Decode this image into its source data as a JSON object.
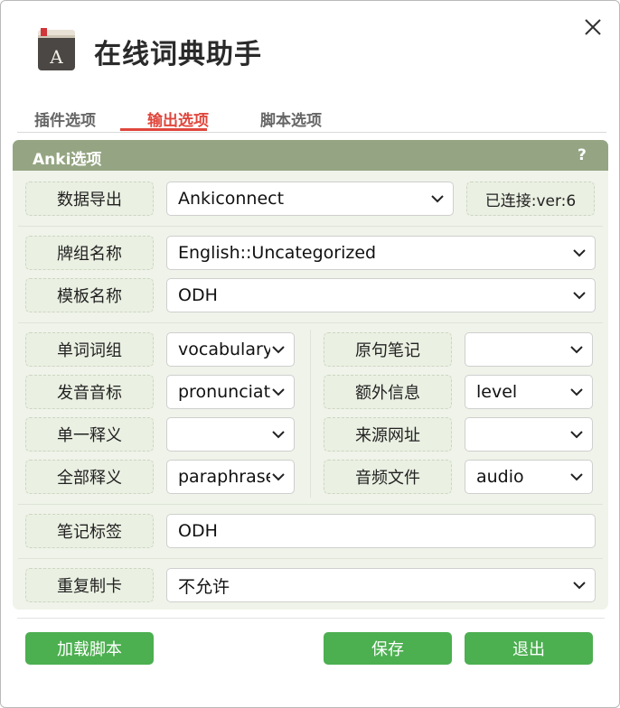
{
  "window": {
    "title": "在线词典助手"
  },
  "tabs": [
    {
      "label": "插件选项",
      "active": false
    },
    {
      "label": "输出选项",
      "active": true
    },
    {
      "label": "脚本选项",
      "active": false
    }
  ],
  "anki": {
    "title": "Anki选项",
    "help": "?",
    "export_label": "数据导出",
    "export_value": "Ankiconnect",
    "status": "已连接:ver:6",
    "deck_label": "牌组名称",
    "deck_value": "English::Uncategorized",
    "model_label": "模板名称",
    "model_value": "ODH",
    "fields_left": [
      {
        "label": "单词词组",
        "value": "vocabulary"
      },
      {
        "label": "发音音标",
        "value": "pronunciation"
      },
      {
        "label": "单一释义",
        "value": ""
      },
      {
        "label": "全部释义",
        "value": "paraphrase"
      }
    ],
    "fields_right": [
      {
        "label": "原句笔记",
        "value": ""
      },
      {
        "label": "额外信息",
        "value": "level"
      },
      {
        "label": "来源网址",
        "value": ""
      },
      {
        "label": "音频文件",
        "value": "audio"
      }
    ],
    "tags_label": "笔记标签",
    "tags_value": "ODH",
    "duplicate_label": "重复制卡",
    "duplicate_value": "不允许"
  },
  "buttons": {
    "load_script": "加载脚本",
    "save": "保存",
    "exit": "退出"
  },
  "colors": {
    "accent": "#e0463c",
    "panel_header": "#95a583",
    "panel_bg": "#eff3e9",
    "button": "#4caf50"
  }
}
